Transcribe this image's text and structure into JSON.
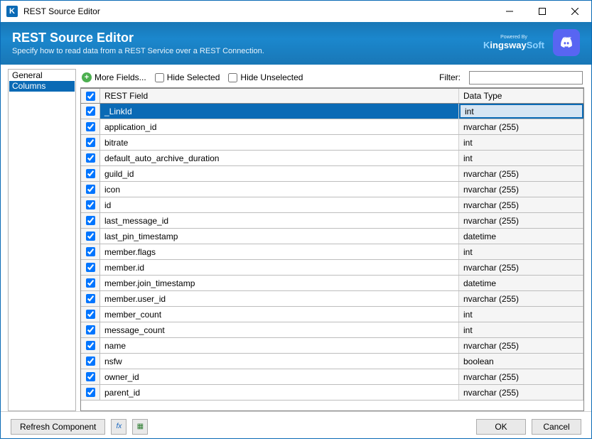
{
  "window": {
    "app_icon_letter": "K",
    "title": "REST Source Editor"
  },
  "header": {
    "title": "REST Source Editor",
    "subtitle": "Specify how to read data from a REST Service over a REST Connection.",
    "powered_by": "Powered By",
    "brand_k": "K",
    "brand_ingsway": "ingsway",
    "brand_soft": "Soft"
  },
  "sidebar": {
    "items": [
      {
        "label": "General",
        "selected": false
      },
      {
        "label": "Columns",
        "selected": true
      }
    ]
  },
  "toolbar": {
    "more_fields": "More Fields...",
    "hide_selected": "Hide Selected",
    "hide_unselected": "Hide Unselected",
    "filter_label": "Filter:",
    "filter_value": ""
  },
  "grid": {
    "columns": {
      "field": "REST Field",
      "type": "Data Type"
    },
    "rows": [
      {
        "field": "_LinkId",
        "type": "int",
        "checked": true,
        "selected": true
      },
      {
        "field": "application_id",
        "type": "nvarchar (255)",
        "checked": true
      },
      {
        "field": "bitrate",
        "type": "int",
        "checked": true
      },
      {
        "field": "default_auto_archive_duration",
        "type": "int",
        "checked": true
      },
      {
        "field": "guild_id",
        "type": "nvarchar (255)",
        "checked": true
      },
      {
        "field": "icon",
        "type": "nvarchar (255)",
        "checked": true
      },
      {
        "field": "id",
        "type": "nvarchar (255)",
        "checked": true
      },
      {
        "field": "last_message_id",
        "type": "nvarchar (255)",
        "checked": true
      },
      {
        "field": "last_pin_timestamp",
        "type": "datetime",
        "checked": true
      },
      {
        "field": "member.flags",
        "type": "int",
        "checked": true
      },
      {
        "field": "member.id",
        "type": "nvarchar (255)",
        "checked": true
      },
      {
        "field": "member.join_timestamp",
        "type": "datetime",
        "checked": true
      },
      {
        "field": "member.user_id",
        "type": "nvarchar (255)",
        "checked": true
      },
      {
        "field": "member_count",
        "type": "int",
        "checked": true
      },
      {
        "field": "message_count",
        "type": "int",
        "checked": true
      },
      {
        "field": "name",
        "type": "nvarchar (255)",
        "checked": true
      },
      {
        "field": "nsfw",
        "type": "boolean",
        "checked": true
      },
      {
        "field": "owner_id",
        "type": "nvarchar (255)",
        "checked": true
      },
      {
        "field": "parent_id",
        "type": "nvarchar (255)",
        "checked": true
      }
    ]
  },
  "footer": {
    "refresh": "Refresh Component",
    "ok": "OK",
    "cancel": "Cancel"
  }
}
